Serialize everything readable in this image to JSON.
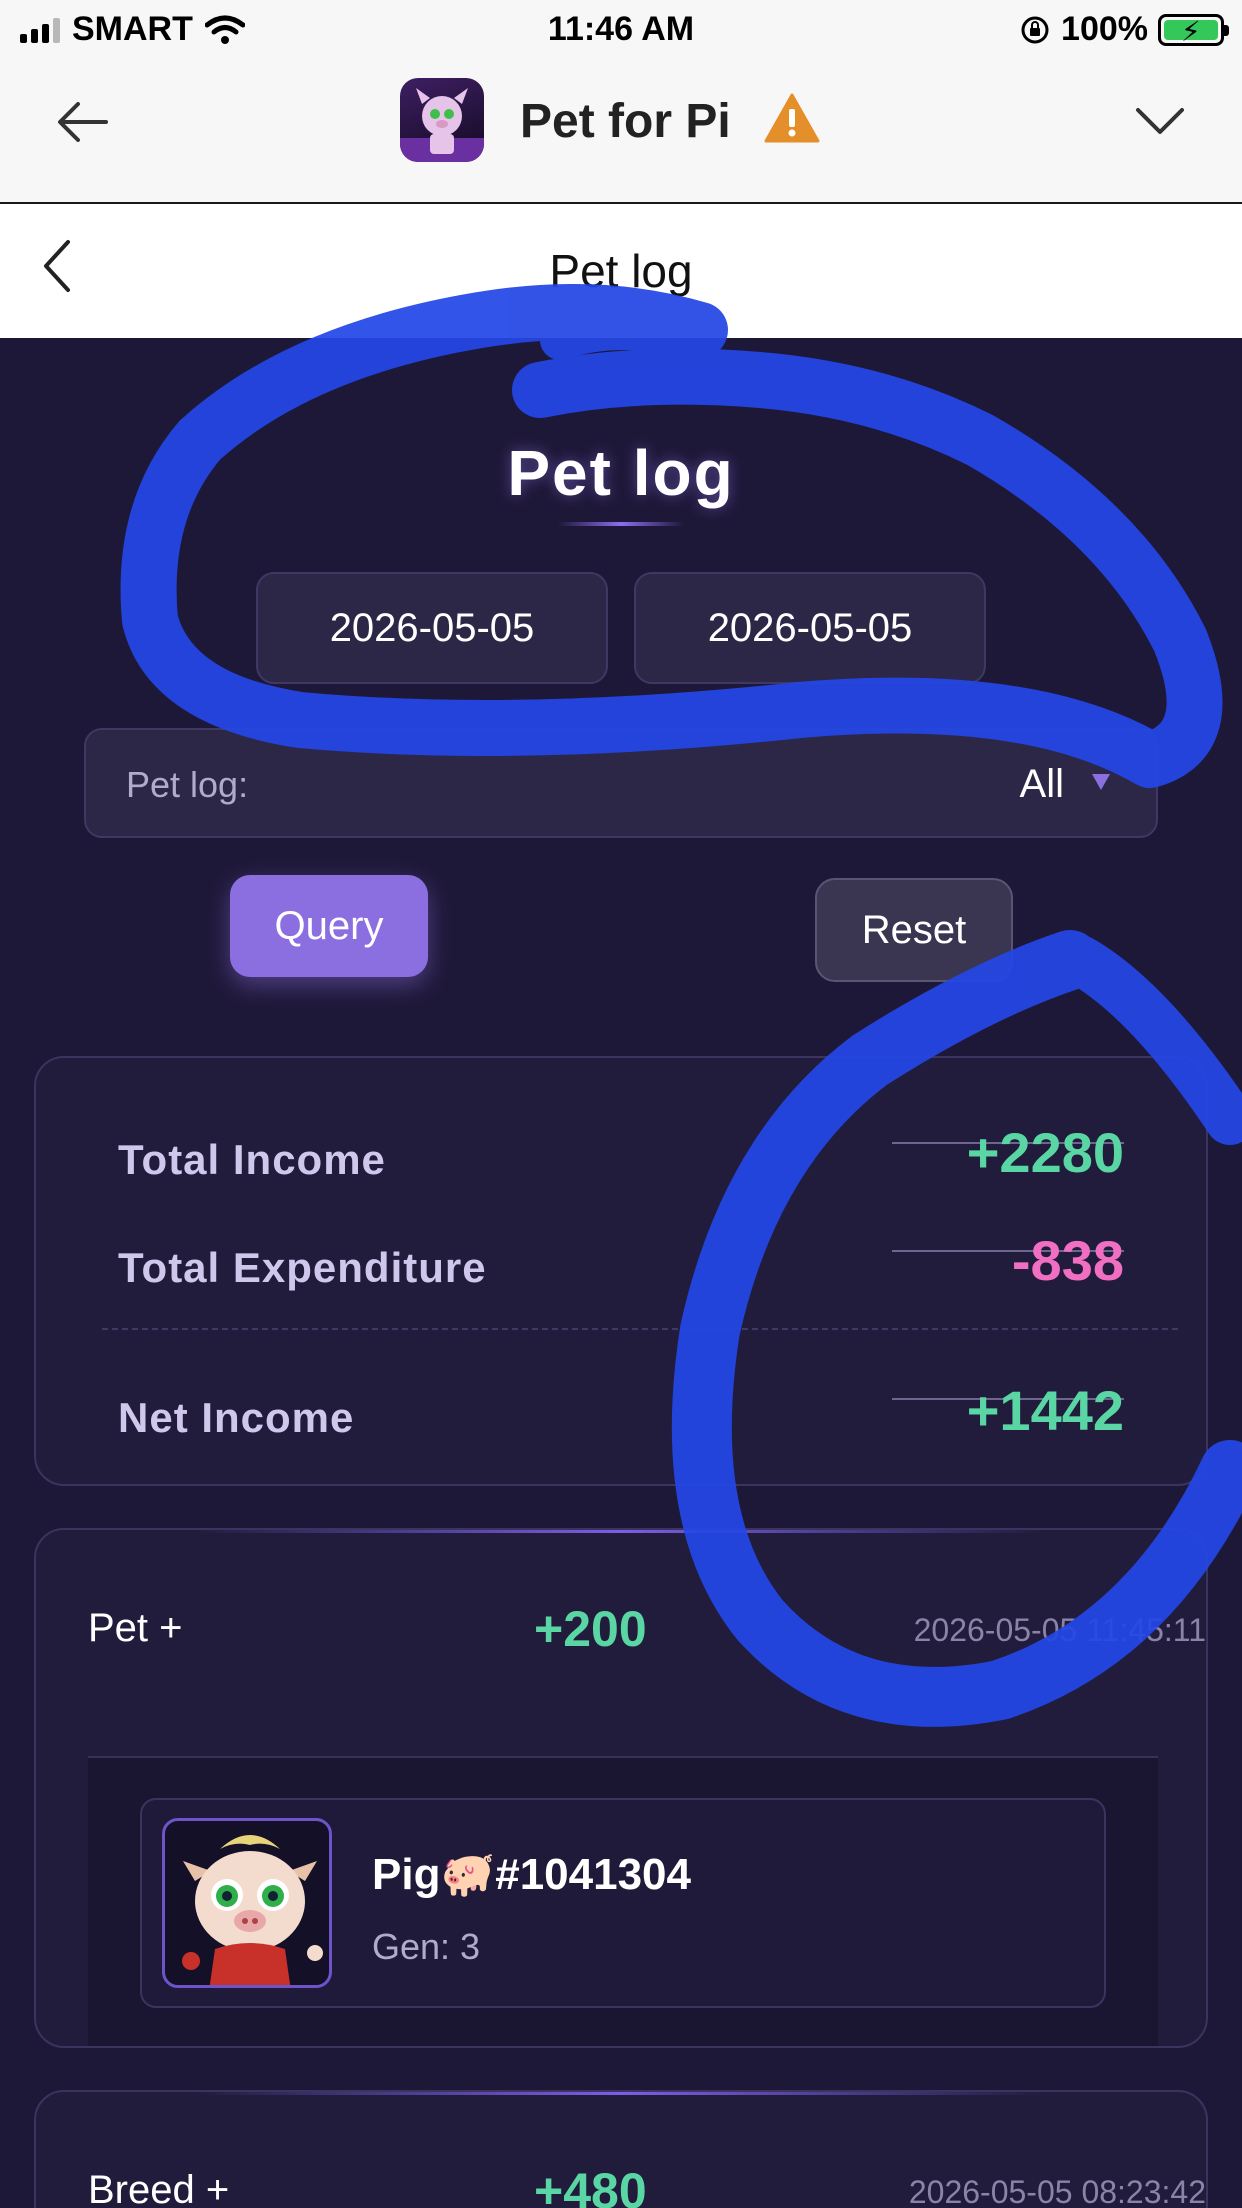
{
  "status_bar": {
    "carrier": "SMART",
    "time": "11:46 AM",
    "battery": "100%"
  },
  "browser": {
    "app_title": "Pet for Pi"
  },
  "page": {
    "header_title": "Pet log",
    "hero_title": "Pet log"
  },
  "filters": {
    "start_date": "2026-05-05",
    "end_date": "2026-05-05",
    "log_label": "Pet log:",
    "log_value": "All",
    "query_label": "Query",
    "reset_label": "Reset"
  },
  "summary": {
    "total_income_label": "Total Income",
    "total_income_value": "+2280",
    "total_expenditure_label": "Total Expenditure",
    "total_expenditure_value": "-838",
    "net_income_label": "Net Income",
    "net_income_value": "+1442"
  },
  "logs": [
    {
      "type": "Pet +",
      "amount": "+200",
      "time": "2026-05-05 11:45:11",
      "pet": {
        "name": "Pig🐖#1041304",
        "gen": "Gen: 3"
      }
    },
    {
      "type": "Breed +",
      "amount": "+480",
      "time": "2026-05-05 08:23:42"
    }
  ],
  "colors": {
    "income": "#5ad6a4",
    "expenditure": "#f06fc2",
    "accent": "#8b6fe0",
    "background": "#1e1838"
  }
}
